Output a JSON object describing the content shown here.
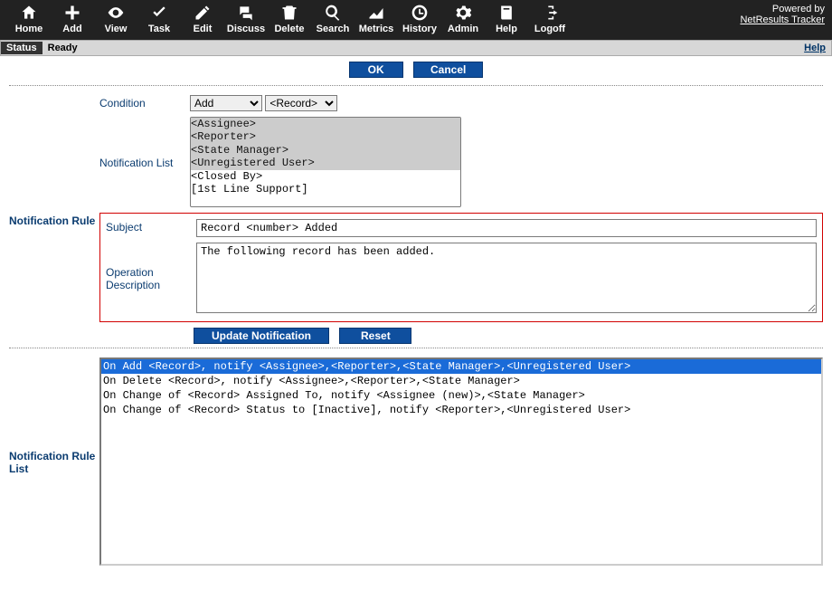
{
  "powered_by": "Powered by",
  "product_link": "NetResults Tracker",
  "toolbar": {
    "home": "Home",
    "add": "Add",
    "view": "View",
    "task": "Task",
    "edit": "Edit",
    "discuss": "Discuss",
    "delete": "Delete",
    "search": "Search",
    "metrics": "Metrics",
    "history": "History",
    "admin": "Admin",
    "help": "Help",
    "logoff": "Logoff"
  },
  "status": {
    "label": "Status",
    "value": "Ready",
    "help": "Help"
  },
  "buttons": {
    "ok": "OK",
    "cancel": "Cancel",
    "update": "Update Notification",
    "reset": "Reset"
  },
  "section1_label": "Notification Rule",
  "section2_label": "Notification Rule List",
  "fields": {
    "condition_label": "Condition",
    "notiflist_label": "Notification List",
    "subject_label": "Subject",
    "opdesc_label": "Operation Description"
  },
  "condition": {
    "action": "Add",
    "target": "<Record>"
  },
  "notification_list": [
    {
      "label": "<Assignee>",
      "selected": true
    },
    {
      "label": "<Reporter>",
      "selected": true
    },
    {
      "label": "<State Manager>",
      "selected": true
    },
    {
      "label": "<Unregistered User>",
      "selected": true
    },
    {
      "label": "<Closed By>",
      "selected": false
    },
    {
      "label": "[1st Line Support]",
      "selected": false
    }
  ],
  "subject_value": "Record <number> Added",
  "opdesc_value": "The following record has been added.",
  "rules": [
    {
      "text": "On Add <Record>, notify <Assignee>,<Reporter>,<State Manager>,<Unregistered User>",
      "active": true
    },
    {
      "text": "On Delete <Record>, notify <Assignee>,<Reporter>,<State Manager>",
      "active": false
    },
    {
      "text": "On Change of <Record> Assigned To, notify <Assignee (new)>,<State Manager>",
      "active": false
    },
    {
      "text": "On Change of <Record> Status to [Inactive], notify <Reporter>,<Unregistered User>",
      "active": false
    }
  ]
}
